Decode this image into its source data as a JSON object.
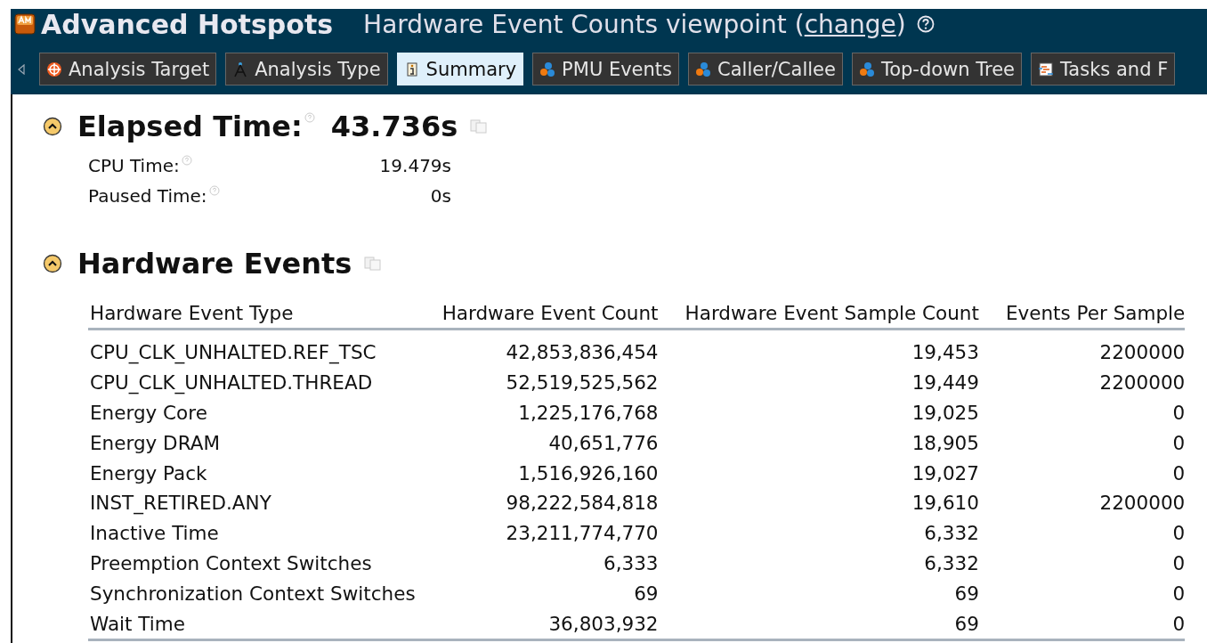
{
  "header": {
    "analysis": "Advanced Hotspots",
    "viewpoint": "Hardware Event Counts viewpoint (",
    "change_link": "change",
    "viewpoint_end": ")"
  },
  "tabs": [
    {
      "label": "Analysis Target",
      "kind": "target",
      "selected": false
    },
    {
      "label": "Analysis Type",
      "kind": "compass",
      "selected": false
    },
    {
      "label": "Summary",
      "kind": "info",
      "selected": true
    },
    {
      "label": "PMU Events",
      "kind": "balls",
      "selected": false
    },
    {
      "label": "Caller/Callee",
      "kind": "balls",
      "selected": false
    },
    {
      "label": "Top-down Tree",
      "kind": "balls",
      "selected": false
    },
    {
      "label": "Tasks and F",
      "kind": "tasks",
      "selected": false
    }
  ],
  "elapsed": {
    "title": "Elapsed Time:",
    "value": "43.736s",
    "expanded": true,
    "metrics": [
      {
        "label": "CPU Time:",
        "value": "19.479s"
      },
      {
        "label": "Paused Time:",
        "value": "0s"
      }
    ]
  },
  "hardware_events": {
    "title": "Hardware Events",
    "expanded": true,
    "columns": [
      "Hardware Event Type",
      "Hardware Event Count",
      "Hardware Event Sample Count",
      "Events Per Sample"
    ],
    "rows": [
      [
        "CPU_CLK_UNHALTED.REF_TSC",
        "42,853,836,454",
        "19,453",
        "2200000"
      ],
      [
        "CPU_CLK_UNHALTED.THREAD",
        "52,519,525,562",
        "19,449",
        "2200000"
      ],
      [
        "Energy Core",
        "1,225,176,768",
        "19,025",
        "0"
      ],
      [
        "Energy DRAM",
        "40,651,776",
        "18,905",
        "0"
      ],
      [
        "Energy Pack",
        "1,516,926,160",
        "19,027",
        "0"
      ],
      [
        "INST_RETIRED.ANY",
        "98,222,584,818",
        "19,610",
        "2200000"
      ],
      [
        "Inactive Time",
        "23,211,774,770",
        "6,332",
        "0"
      ],
      [
        "Preemption Context Switches",
        "6,333",
        "6,332",
        "0"
      ],
      [
        "Synchronization Context Switches",
        "69",
        "69",
        "0"
      ],
      [
        "Wait Time",
        "36,803,932",
        "69",
        "0"
      ]
    ]
  }
}
